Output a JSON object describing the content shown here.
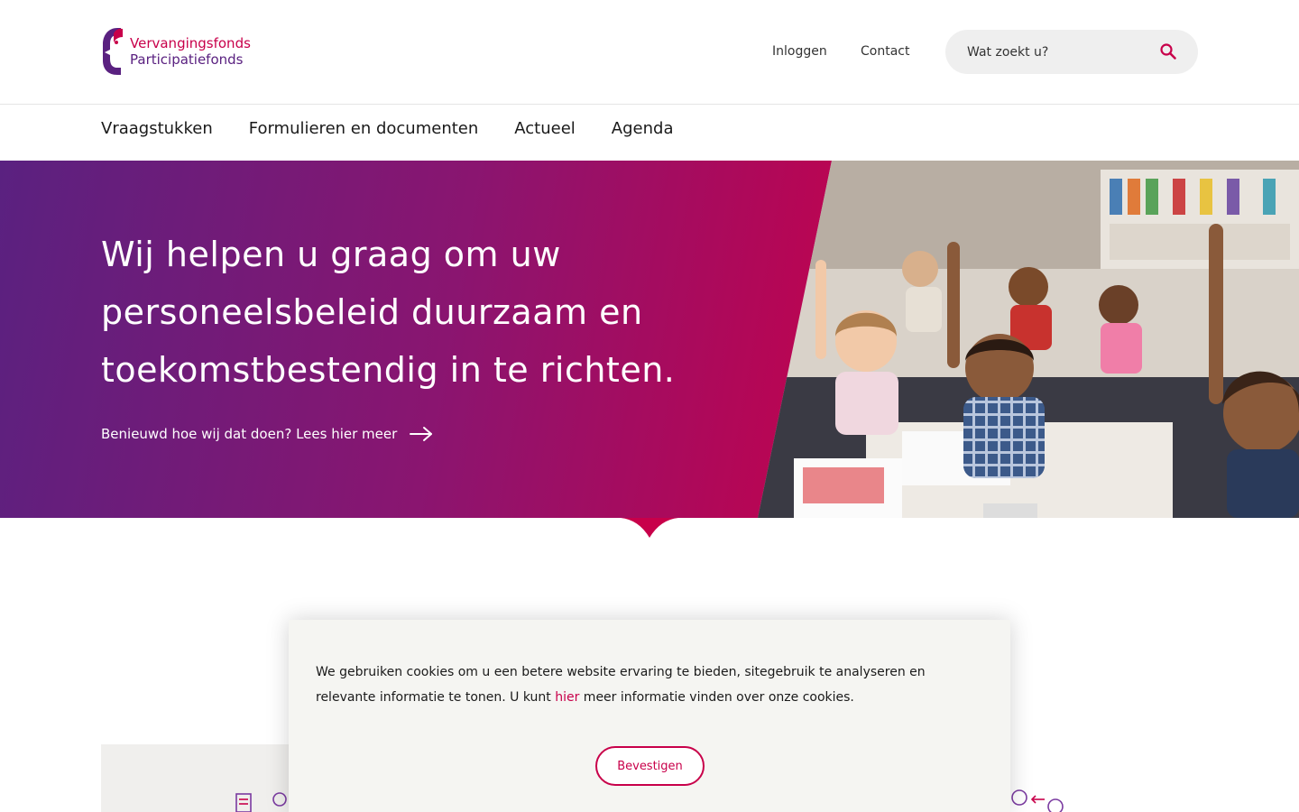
{
  "brand": {
    "name_line1": "Vervangingsfonds",
    "name_line2": "Participatiefonds",
    "primary_color": "#c8004a",
    "secondary_color": "#5a2180"
  },
  "header": {
    "login_label": "Inloggen",
    "contact_label": "Contact",
    "search_placeholder": "Wat zoekt u?",
    "search_icon": "search-icon"
  },
  "nav": {
    "items": [
      {
        "label": "Vraagstukken"
      },
      {
        "label": "Formulieren en documenten"
      },
      {
        "label": "Actueel"
      },
      {
        "label": "Agenda"
      }
    ]
  },
  "hero": {
    "title": "Wij helpen u graag om uw personeelsbeleid duurzaam en toekomstbestendig in te richten.",
    "link_label": "Benieuwd hoe wij dat doen? Lees hier meer",
    "image_subject": "classroom-children-raising-hands-photo"
  },
  "cookie": {
    "text_before": "We gebruiken cookies om u een betere website ervaring te bieden, sitegebruik te analyseren en relevante informatie te tonen. U kunt ",
    "link_label": "hier",
    "text_after": " meer informatie vinden over onze cookies.",
    "button_label": "Bevestigen"
  }
}
